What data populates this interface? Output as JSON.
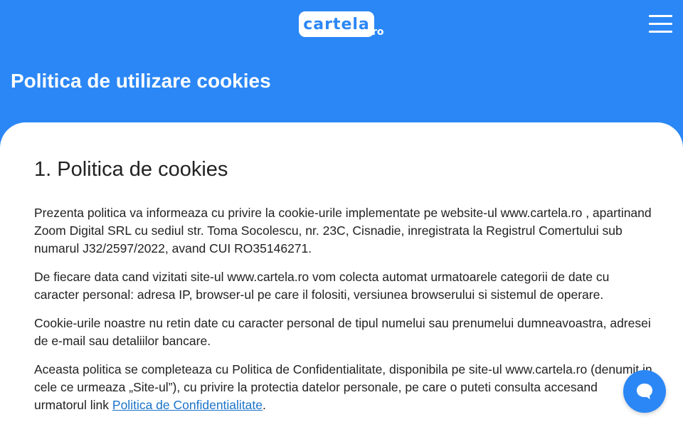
{
  "header": {
    "logo_text": "cartela",
    "logo_suffix": "ro",
    "page_title": "Politica de utilizare cookies"
  },
  "content": {
    "section_title": "1. Politica de cookies",
    "paragraphs": [
      "Prezenta politica va informeaza cu privire la cookie-urile implementate pe website-ul www.cartela.ro , apartinand Zoom Digital SRL cu sediul str. Toma Socolescu, nr. 23C, Cisnadie, inregistrata la Registrul Comertului sub numarul J32/2597/2022, avand CUI RO35146271.",
      "De fiecare data cand vizitati site-ul www.cartela.ro vom colecta automat urmatoarele categorii de date cu caracter personal: adresa IP, browser-ul pe care il folositi, versiunea browserului si sistemul de operare.",
      "Cookie-urile noastre nu retin date cu caracter personal de tipul numelui sau prenumelui dumneavoastra, adresei de e-mail sau detaliilor bancare.",
      "Aceasta politica se completeaza cu Politica de Confidentialitate, disponibila pe site-ul www.cartela.ro (denumit in cele ce urmeaza „Site-ul”), cu privire la protectia datelor personale, pe care o puteti consulta accesand urmatorul link "
    ],
    "link_text": "Politica de Confidentialitate",
    "link_suffix": "."
  },
  "icons": {
    "menu": "hamburger-menu-icon",
    "chat": "chat-bubble-icon"
  },
  "colors": {
    "brand": "#2b87f5",
    "link": "#1a73c9"
  }
}
